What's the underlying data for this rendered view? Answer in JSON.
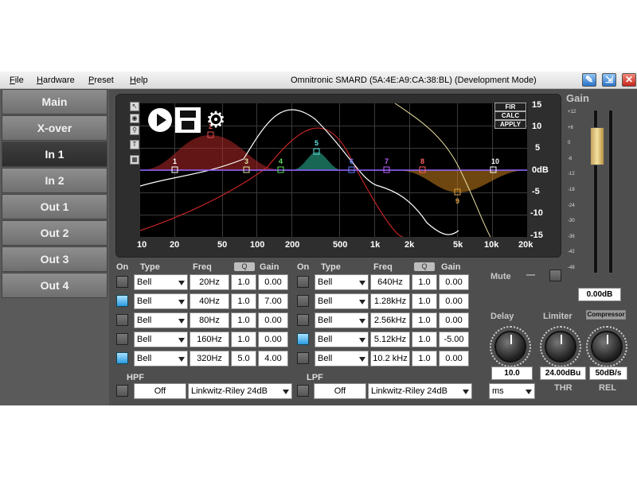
{
  "menu": [
    "File",
    "Hardware",
    "Preset",
    "Help"
  ],
  "window_title": "Omnitronic SMARD (5A:4E:A9:CA:38:BL) (Development Mode)",
  "nav": [
    "Main",
    "X-over",
    "In 1",
    "In 2",
    "Out 1",
    "Out 2",
    "Out 3",
    "Out 4"
  ],
  "active_nav": "In 1",
  "graph": {
    "x_ticks": [
      "10",
      "20",
      "50",
      "100",
      "200",
      "500",
      "1k",
      "2k",
      "5k",
      "10k",
      "20k"
    ],
    "y_ticks": [
      "15",
      "10",
      "5",
      "0dB",
      "-5",
      "-10",
      "-15"
    ],
    "band_markers": [
      "1",
      "2",
      "3",
      "4",
      "5",
      "6",
      "7",
      "8",
      "9",
      "10"
    ],
    "fir_buttons": [
      "FIR",
      "CALC",
      "APPLY"
    ]
  },
  "eq_headers": {
    "on": "On",
    "type": "Type",
    "freq": "Freq",
    "q": "Q",
    "gain": "Gain"
  },
  "eq_left": [
    {
      "on": false,
      "type": "Bell",
      "freq": "20Hz",
      "q": "1.0",
      "gain": "0.00"
    },
    {
      "on": true,
      "type": "Bell",
      "freq": "40Hz",
      "q": "1.0",
      "gain": "7.00"
    },
    {
      "on": false,
      "type": "Bell",
      "freq": "80Hz",
      "q": "1.0",
      "gain": "0.00"
    },
    {
      "on": false,
      "type": "Bell",
      "freq": "160Hz",
      "q": "1.0",
      "gain": "0.00"
    },
    {
      "on": true,
      "type": "Bell",
      "freq": "320Hz",
      "q": "5.0",
      "gain": "4.00"
    }
  ],
  "eq_right": [
    {
      "on": false,
      "type": "Bell",
      "freq": "640Hz",
      "q": "1.0",
      "gain": "0.00"
    },
    {
      "on": false,
      "type": "Bell",
      "freq": "1.28kHz",
      "q": "1.0",
      "gain": "0.00"
    },
    {
      "on": false,
      "type": "Bell",
      "freq": "2.56kHz",
      "q": "1.0",
      "gain": "0.00"
    },
    {
      "on": true,
      "type": "Bell",
      "freq": "5.12kHz",
      "q": "1.0",
      "gain": "-5.00"
    },
    {
      "on": false,
      "type": "Bell",
      "freq": "10.2 kHz",
      "q": "1.0",
      "gain": "0.00"
    }
  ],
  "hpf": {
    "label": "HPF",
    "value": "Off",
    "type": "Linkwitz-Riley 24dB"
  },
  "lpf": {
    "label": "LPF",
    "value": "Off",
    "type": "Linkwitz-Riley 24dB"
  },
  "gain": {
    "label": "Gain",
    "value": "0.00dB",
    "scale": [
      "+12",
      "+6",
      "0",
      "-6",
      "-12",
      "-18",
      "-24",
      "-30",
      "-36",
      "-42",
      "-48"
    ]
  },
  "mute": {
    "label": "Mute",
    "dash": "—"
  },
  "delay": {
    "label": "Delay",
    "value": "10.0",
    "unit": "ms"
  },
  "limiter": {
    "label": "Limiter",
    "compressor_label": "Compressor",
    "thr_value": "24.00dBu",
    "thr_label": "THR",
    "rel_value": "50dB/s",
    "rel_label": "REL"
  },
  "colors": {
    "accent": "#2a9ae0",
    "panel": "#4e4e4e"
  }
}
